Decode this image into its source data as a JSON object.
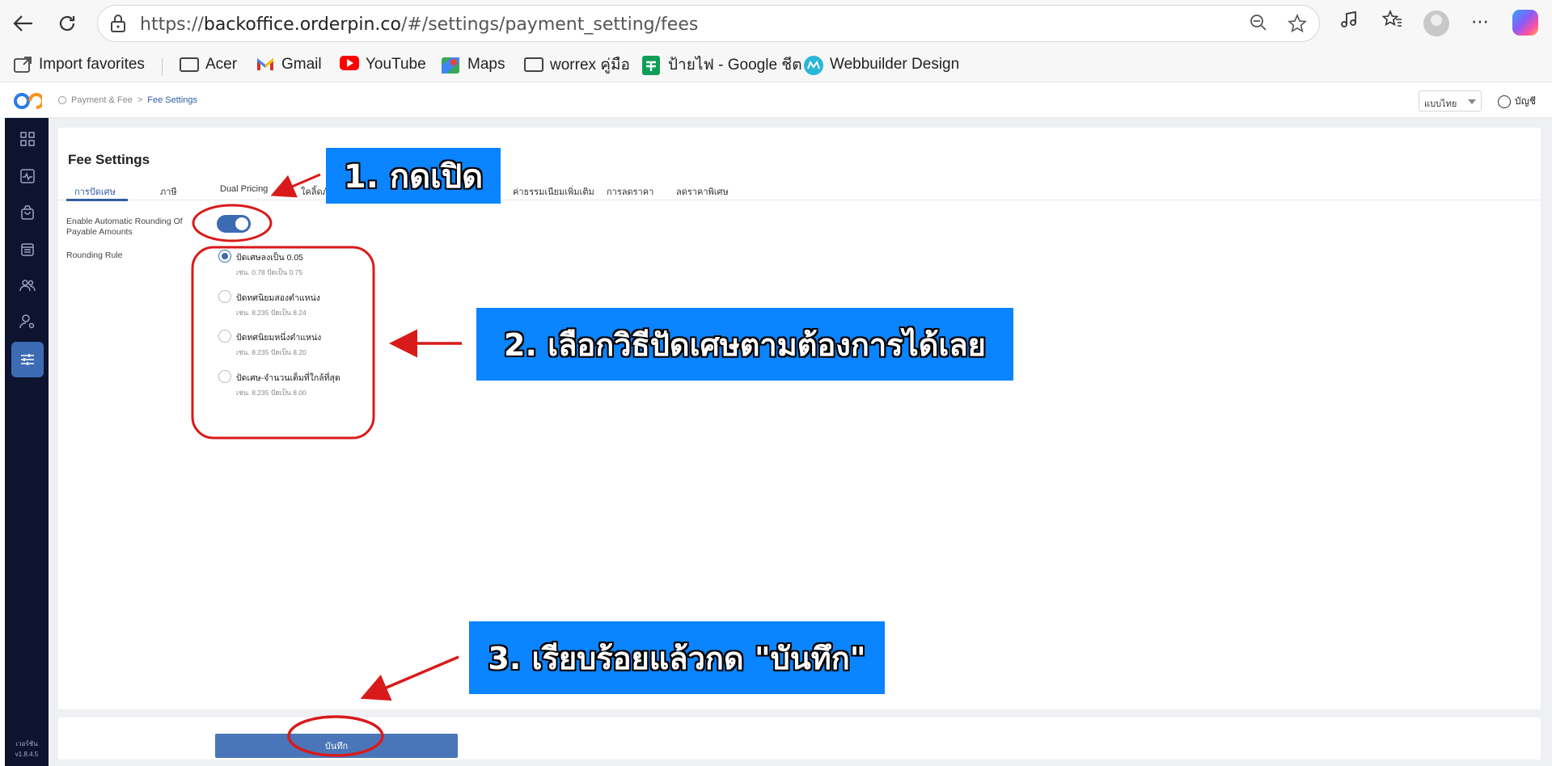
{
  "browser": {
    "url_prefix": "https://",
    "url_domain": "backoffice.orderpin.co",
    "url_path": "/#/settings/payment_setting/fees",
    "back_icon": "back-arrow-icon",
    "refresh_icon": "refresh-icon"
  },
  "bookmarks": [
    {
      "label": "Import favorites",
      "icon": "import-icon"
    },
    {
      "label": "Acer",
      "icon": "folder-icon"
    },
    {
      "label": "Gmail",
      "icon": "gmail-icon"
    },
    {
      "label": "YouTube",
      "icon": "youtube-icon"
    },
    {
      "label": "Maps",
      "icon": "maps-icon"
    },
    {
      "label": "worrex คู่มือ",
      "icon": "folder-icon"
    },
    {
      "label": "ป้ายไฟ - Google ชีต",
      "icon": "sheets-icon"
    },
    {
      "label": "Webbuilder Design",
      "icon": "webbuilder-icon"
    }
  ],
  "header": {
    "breadcrumb_parent": "Payment & Fee",
    "breadcrumb_sep": ">",
    "breadcrumb_current": "Fee Settings",
    "language": "แบบไทย",
    "account": "บัญชี"
  },
  "page": {
    "title": "Fee Settings",
    "tabs": [
      {
        "label": "การปัดเศษ",
        "active": true
      },
      {
        "label": "ภาษี",
        "active": false
      },
      {
        "label": "Dual Pricing",
        "active": false
      },
      {
        "label": "ใคลิ้ดภั",
        "active": false
      },
      {
        "label": "ค่าธรรมเนียมเพิ่มเติม",
        "active": false
      },
      {
        "label": "การลดราคา",
        "active": false
      },
      {
        "label": "ลดราคาพิเศษ",
        "active": false
      }
    ],
    "rounding_toggle_label": "Enable Automatic Rounding Of Payable Amounts",
    "rounding_toggle_on": true,
    "rounding_rule_label": "Rounding Rule",
    "rounding_options": [
      {
        "title": "ปัดเศษลงเป็น 0.05",
        "example": "เช่น. 0.78 ปัดเป็น 0.75",
        "selected": true
      },
      {
        "title": "ปัดทศนิยมสองตำแหน่ง",
        "example": "เช่น. 8.235 ปัดเป็น 8.24",
        "selected": false
      },
      {
        "title": "ปัดทศนิยมหนึ่งตำแหน่ง",
        "example": "เช่น. 8.235 ปัดเป็น 8.20",
        "selected": false
      },
      {
        "title": "ปัดเศษ-จำนวนเต็มที่ใกล้ที่สุด",
        "example": "เช่น. 8.235 ปัดเป็น 8.00",
        "selected": false
      }
    ],
    "save_label": "บันทึก"
  },
  "sidebar": {
    "version_label": "เวอร์ชัน",
    "version": "v1.8.4.5"
  },
  "annotations": {
    "step1": "1. กดเปิด",
    "step2": "2. เลือกวิธีปัดเศษตามต้องการได้เลย",
    "step3": "3. เรียบร้อยแล้วกด \"บันทึก\"",
    "callout_color": "#0a84ff",
    "marker_color": "#d91a1a"
  }
}
